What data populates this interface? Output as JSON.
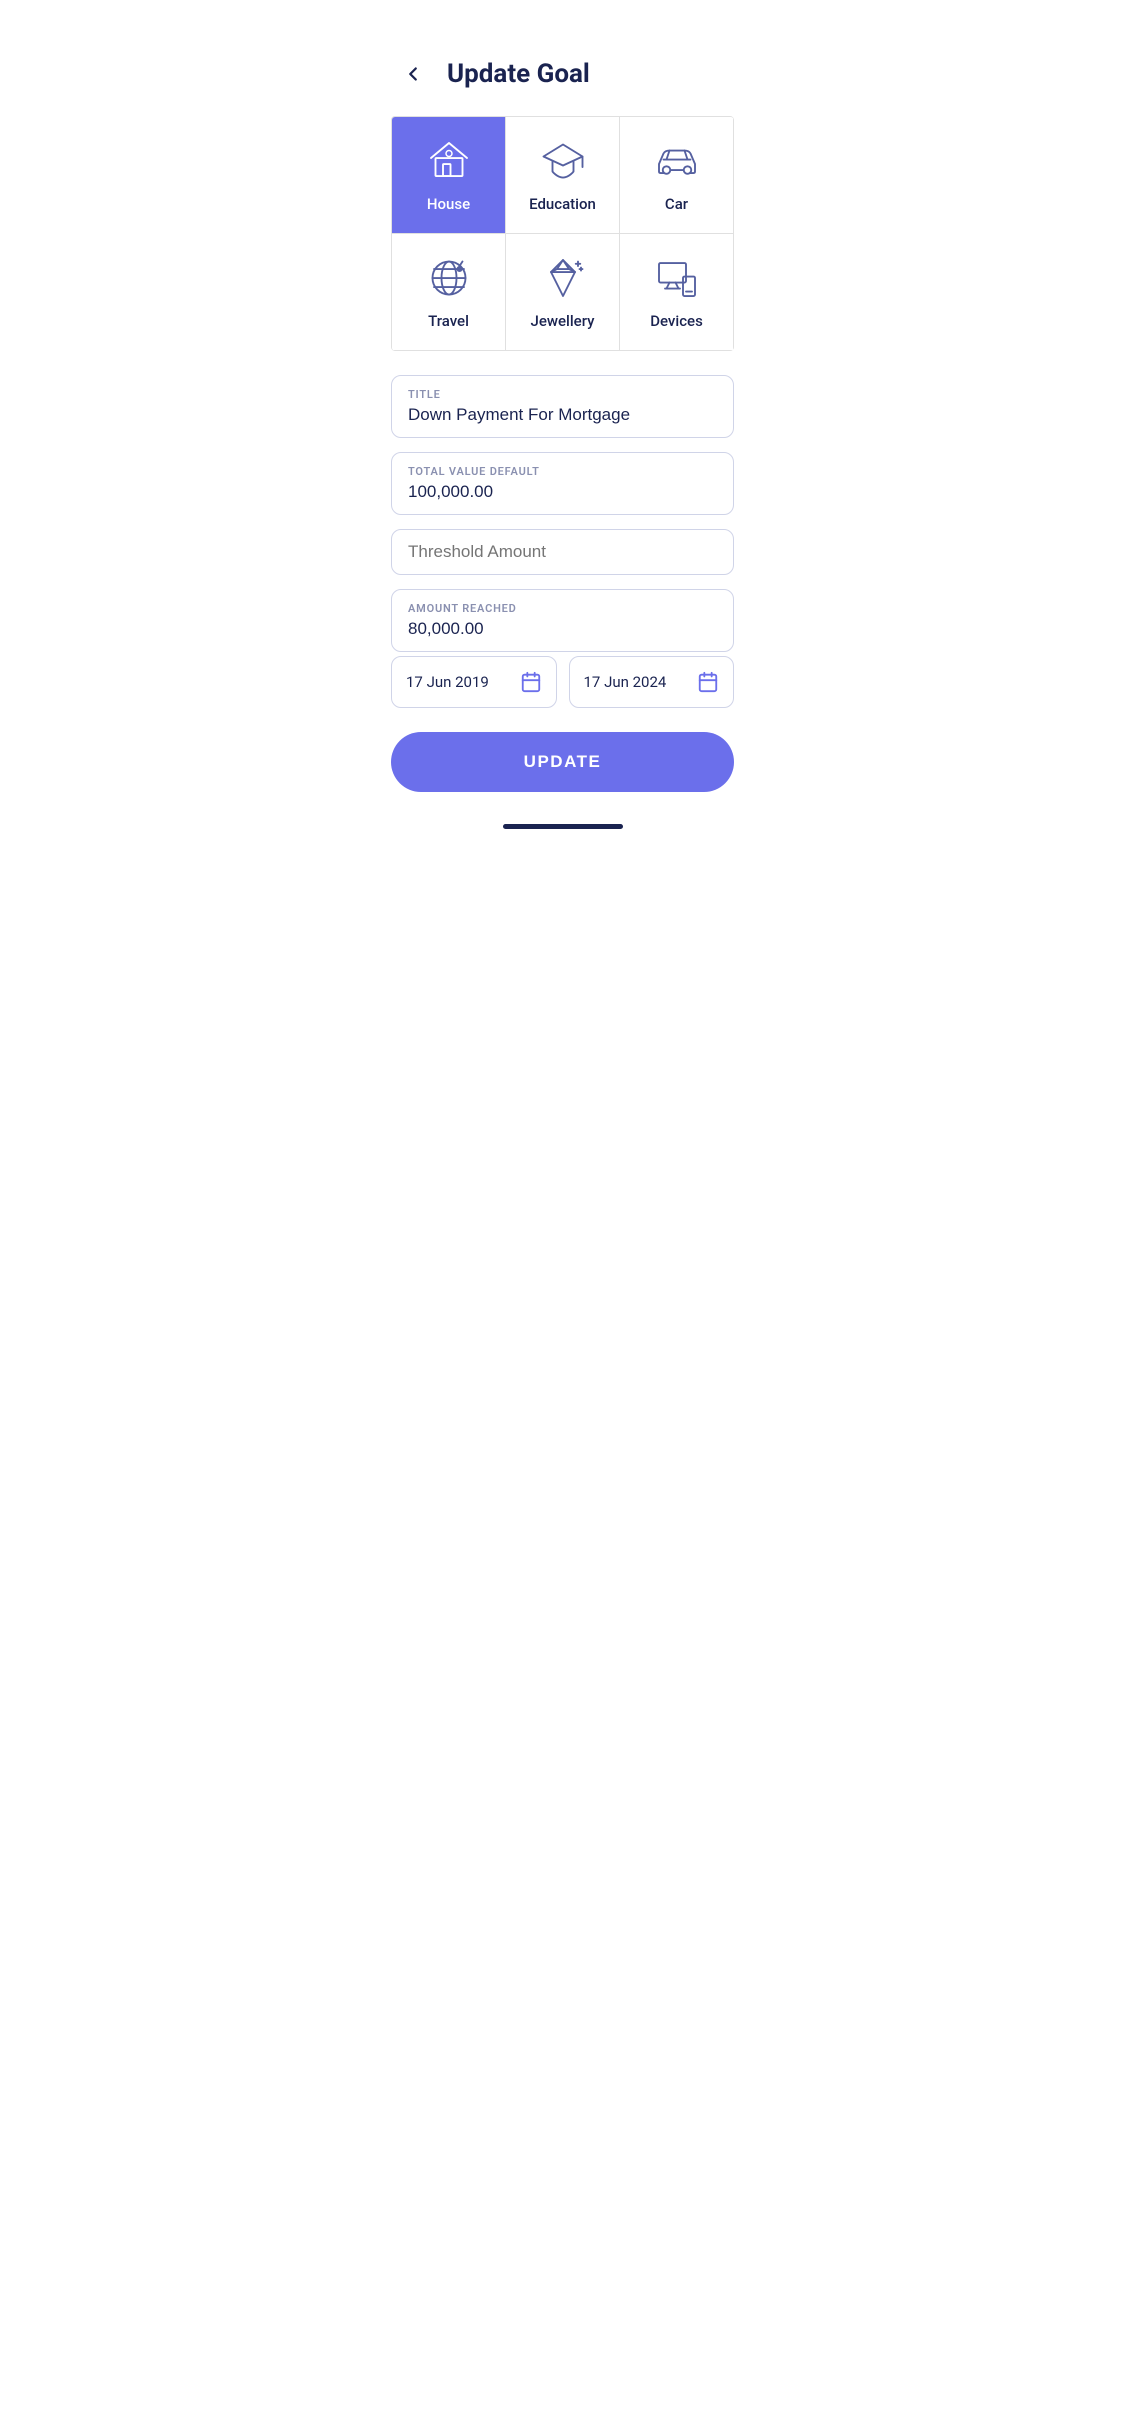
{
  "header": {
    "title": "Update Goal",
    "back_label": "back"
  },
  "categories": [
    {
      "id": "house",
      "label": "House",
      "active": true
    },
    {
      "id": "education",
      "label": "Education",
      "active": false
    },
    {
      "id": "car",
      "label": "Car",
      "active": false
    },
    {
      "id": "travel",
      "label": "Travel",
      "active": false
    },
    {
      "id": "jewellery",
      "label": "Jewellery",
      "active": false
    },
    {
      "id": "devices",
      "label": "Devices",
      "active": false
    }
  ],
  "form": {
    "title_label": "TITLE",
    "title_value": "Down Payment For Mortgage",
    "total_value_label": "TOTAL VALUE DEFAULT",
    "total_value": "100,000.00",
    "threshold_placeholder": "Threshold Amount",
    "amount_reached_label": "AMOUNT REACHED",
    "amount_reached": "80,000.00",
    "start_date": "17 Jun 2019",
    "end_date": "17 Jun 2024"
  },
  "actions": {
    "update_label": "UPDATE"
  }
}
